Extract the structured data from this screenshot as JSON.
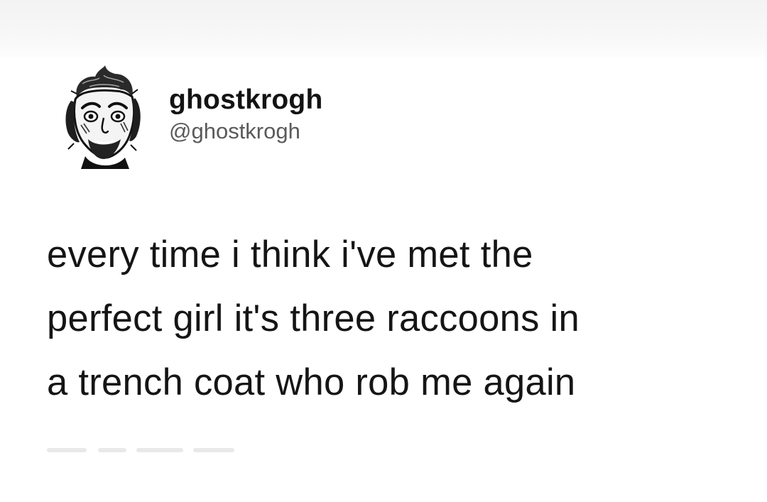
{
  "tweet": {
    "author": {
      "display_name": "ghostkrogh",
      "handle": "@ghostkrogh",
      "avatar_icon": "avatar-sketch-face-icon"
    },
    "text_lines": [
      "every time i think i've met the",
      "perfect girl it's three raccoons in",
      "a trench coat who rob me again"
    ]
  },
  "colors": {
    "text": "#151515",
    "handle": "#5a5a5a",
    "background": "#ffffff"
  }
}
